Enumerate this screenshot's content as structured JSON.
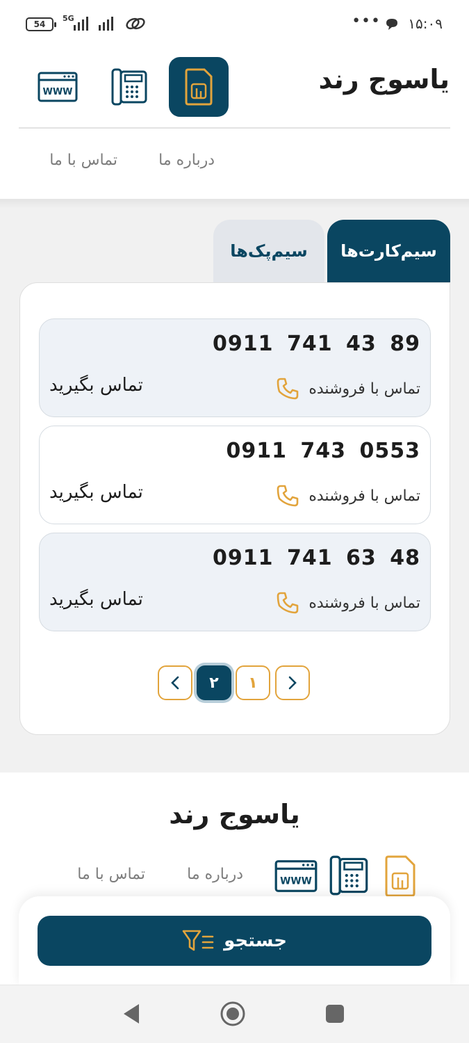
{
  "status_bar": {
    "battery": "54",
    "network": "5G",
    "time": "۱۵:۰۹",
    "dots": "•••"
  },
  "header": {
    "brand": "یاسوج رند",
    "nav": {
      "about": "درباره ما",
      "contact": "تماس با ما"
    },
    "icons": [
      "sim-card-icon",
      "office-phone-icon",
      "web-browser-icon"
    ]
  },
  "tabs": {
    "sim_cards": "سیم‌کارت‌ها",
    "sim_packs": "سیم‌پک‌ها"
  },
  "listings": [
    {
      "number": "0911 741 43 89",
      "seller_label": "تماس با فروشنده",
      "cta": "تماس بگیرید"
    },
    {
      "number": "0911 743 0553",
      "seller_label": "تماس با فروشنده",
      "cta": "تماس بگیرید"
    },
    {
      "number": "0911 741 63 48",
      "seller_label": "تماس با فروشنده",
      "cta": "تماس بگیرید"
    }
  ],
  "pagination": {
    "pages": [
      "۱",
      "۲"
    ],
    "current": "۲"
  },
  "footer": {
    "brand": "یاسوج رند",
    "about": "درباره ما",
    "contact": "تماس با ما"
  },
  "search": {
    "label": "جستجو"
  },
  "colors": {
    "primary": "#0a4661",
    "accent": "#e2a43c",
    "card_tint": "#eef2f7",
    "page_bg": "#f1f1f1"
  }
}
